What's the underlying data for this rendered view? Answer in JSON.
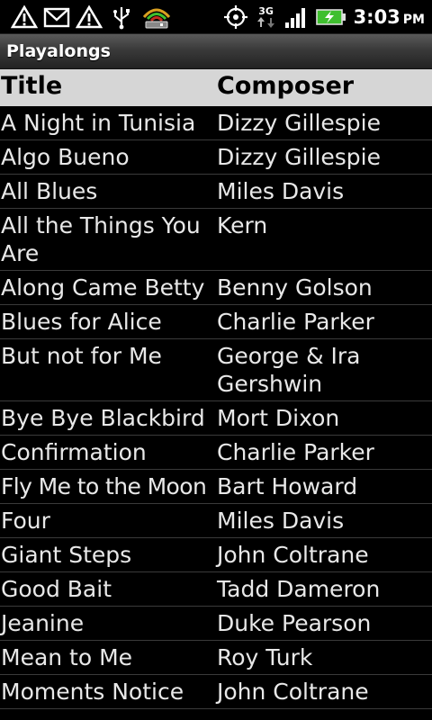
{
  "status_bar": {
    "left_icons": [
      "warning-icon",
      "gmail-icon",
      "warning-icon",
      "usb-icon",
      "wifi-router-icon"
    ],
    "right_icons": [
      "gps-icon",
      "network-3g-icon",
      "signal-icon",
      "battery-charging-icon"
    ],
    "network_type": "3G",
    "time": "3:03",
    "ampm": "PM",
    "colors": {
      "battery": "#3fbf2f",
      "router_arc": "#d9a020"
    }
  },
  "app": {
    "title": "Playalongs"
  },
  "table": {
    "headers": {
      "title": "Title",
      "composer": "Composer"
    },
    "rows": [
      {
        "title": "A Night in Tunisia",
        "composer": "Dizzy Gillespie"
      },
      {
        "title": "Algo Bueno",
        "composer": "Dizzy Gillespie"
      },
      {
        "title": "All Blues",
        "composer": "Miles Davis"
      },
      {
        "title": "All the Things You Are",
        "composer": "Kern"
      },
      {
        "title": "Along Came Betty",
        "composer": "Benny Golson"
      },
      {
        "title": "Blues for Alice",
        "composer": "Charlie Parker"
      },
      {
        "title": "But not for Me",
        "composer": "George & Ira Gershwin"
      },
      {
        "title": "Bye Bye Blackbird",
        "composer": "Mort Dixon"
      },
      {
        "title": "Confirmation",
        "composer": "Charlie Parker"
      },
      {
        "title": "Fly Me to the Moon",
        "composer": "Bart Howard"
      },
      {
        "title": "Four",
        "composer": "Miles Davis"
      },
      {
        "title": "Giant Steps",
        "composer": "John Coltrane"
      },
      {
        "title": "Good Bait",
        "composer": "Tadd Dameron"
      },
      {
        "title": "Jeanine",
        "composer": "Duke Pearson"
      },
      {
        "title": "Mean to Me",
        "composer": "Roy Turk"
      },
      {
        "title": "Moments Notice",
        "composer": "John Coltrane"
      }
    ]
  }
}
